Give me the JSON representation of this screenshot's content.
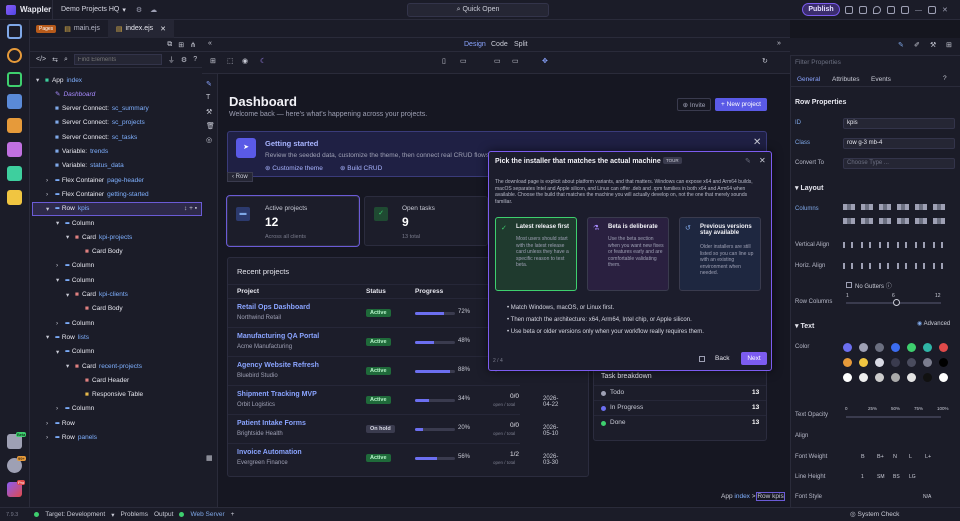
{
  "app": {
    "logo": "Wappler",
    "project": "Demo Projects HQ",
    "quick_open": "Quick Open",
    "publish": "Publish"
  },
  "tabs": [
    {
      "label": "Pages"
    },
    {
      "label": "main.ejs"
    },
    {
      "label": "index.ejs"
    }
  ],
  "tree": {
    "search_placeholder": "Find Elements",
    "nodes": [
      {
        "type": "App",
        "name": "index"
      },
      {
        "type": "Dashboard",
        "name": ""
      },
      {
        "type": "Server Connect:",
        "name": "sc_summary"
      },
      {
        "type": "Server Connect:",
        "name": "sc_projects"
      },
      {
        "type": "Server Connect:",
        "name": "sc_tasks"
      },
      {
        "type": "Variable:",
        "name": "trends"
      },
      {
        "type": "Variable:",
        "name": "status_data"
      },
      {
        "type": "Flex Container",
        "name": "page-header"
      },
      {
        "type": "Flex Container",
        "name": "getting-started"
      },
      {
        "type": "Row",
        "name": "kpis"
      },
      {
        "type": "Column",
        "name": ""
      },
      {
        "type": "Card",
        "name": "kpi-projects"
      },
      {
        "type": "Card Body",
        "name": ""
      },
      {
        "type": "Column",
        "name": ""
      },
      {
        "type": "Column",
        "name": ""
      },
      {
        "type": "Card",
        "name": "kpi-clients"
      },
      {
        "type": "Card Body",
        "name": ""
      },
      {
        "type": "Column",
        "name": ""
      },
      {
        "type": "Row",
        "name": "lists"
      },
      {
        "type": "Column",
        "name": ""
      },
      {
        "type": "Card",
        "name": "recent-projects"
      },
      {
        "type": "Card Header",
        "name": ""
      },
      {
        "type": "Responsive Table",
        "name": ""
      },
      {
        "type": "Column",
        "name": ""
      },
      {
        "type": "Row",
        "name": ""
      },
      {
        "type": "Row",
        "name": "panels"
      }
    ]
  },
  "view_modes": {
    "design": "Design",
    "code": "Code",
    "split": "Split"
  },
  "page": {
    "title": "Dashboard",
    "subtitle": "Welcome back — here's what's happening across your projects.",
    "invite": "Invite",
    "new_project": "+ New project",
    "banner_title": "Getting started",
    "banner_text": "Review the seeded data, customize the theme, then connect real CRUD flows.",
    "banner_link1": "Customize theme",
    "banner_link2": "Build CRUD",
    "row_chip": "Row",
    "kpi1": {
      "label": "Active projects",
      "value": "12",
      "sub": "Across all clients"
    },
    "kpi2": {
      "label": "Open tasks",
      "value": "9",
      "sub": "13 total"
    },
    "recent_title": "Recent projects",
    "cols": [
      "Project",
      "Status",
      "Progress"
    ],
    "projects": [
      {
        "name": "Retail Ops Dashboard",
        "client": "Northwind Retail",
        "status": "Active",
        "progress": 72,
        "pct": "72%"
      },
      {
        "name": "Manufacturing QA Portal",
        "client": "Acme Manufacturing",
        "status": "Active",
        "progress": 48,
        "pct": "48%"
      },
      {
        "name": "Agency Website Refresh",
        "client": "Bluebird Studio",
        "status": "Active",
        "progress": 88,
        "pct": "88%",
        "extra": "open / total"
      },
      {
        "name": "Shipment Tracking MVP",
        "client": "Orbit Logistics",
        "status": "Active",
        "progress": 34,
        "pct": "34%",
        "tasks": "0/0",
        "extra": "open / total",
        "date": "2026-04-22"
      },
      {
        "name": "Patient Intake Forms",
        "client": "Brightside Health",
        "status": "On hold",
        "progress": 20,
        "pct": "20%",
        "tasks": "0/0",
        "extra": "open / total",
        "date": "2026-05-10"
      },
      {
        "name": "Invoice Automation",
        "client": "Evergreen Finance",
        "status": "Active",
        "progress": 56,
        "pct": "56%",
        "tasks": "1/2",
        "extra": "open / total",
        "date": "2026-03-30"
      }
    ],
    "task_title": "Task breakdown",
    "tasks": [
      {
        "label": "Todo",
        "value": "13",
        "color": "#9ea0b4"
      },
      {
        "label": "In Progress",
        "value": "13",
        "color": "#6c6ff0"
      },
      {
        "label": "Done",
        "value": "13",
        "color": "#3ecf6e"
      }
    ]
  },
  "tour": {
    "title": "Pick the installer that matches the actual machine",
    "tag": "TOUR",
    "intro": "The download page is explicit about platform variants, and that matters. Windows can expose x64 and Arm64 builds, macOS separates Intel and Apple silicon, and Linux can offer .deb and .rpm families in both x64 and Arm64 when available. Choose the build that matches the machine you will actually develop on, not the one that merely sounds familiar.",
    "cards": [
      {
        "title": "Latest release first",
        "text": "Most users should start with the latest release card unless they have a specific reason to test beta."
      },
      {
        "title": "Beta is deliberate",
        "text": "Use the beta section when you want new fixes or features early and are comfortable validating them."
      },
      {
        "title": "Previous versions stay available",
        "text": "Older installers are still listed so you can line up with an existing environment when needed."
      }
    ],
    "bullets": [
      "Match Windows, macOS, or Linux first.",
      "Then match the architecture: x64, Arm64, Intel chip, or Apple silicon.",
      "Use beta or older versions only when your workflow really requires them."
    ],
    "step": "2 / 4",
    "back": "Back",
    "next": "Next"
  },
  "breadcrumb": {
    "app": "App",
    "app_name": "index",
    "sep": ">",
    "current": "Row kpis"
  },
  "props": {
    "filter_placeholder": "Filter Properties",
    "tabs": [
      "General",
      "Attributes",
      "Events"
    ],
    "row_properties": "Row Properties",
    "id_label": "ID",
    "id_value": "kpis",
    "class_label": "Class",
    "class_value": "row g-3 mb-4",
    "convert_label": "Convert To",
    "convert_placeholder": "Choose Type ...",
    "layout": "Layout",
    "columns": "Columns",
    "valign": "Vertical Align",
    "halign": "Horiz. Align",
    "no_gutters": "No Gutters",
    "row_columns": "Row Columns",
    "rc_ticks": [
      "1",
      "6",
      "12"
    ],
    "text": "Text",
    "advanced": "Advanced",
    "color": "Color",
    "swatches": [
      "#6c6ff0",
      "#9ea0b4",
      "#6b6f80",
      "#3b6cf0",
      "#3ecf6e",
      "#2fb5a6",
      "#e04a4a",
      "#e69a3a",
      "#f0c541",
      "#d8d9e4",
      "#3a3b4e",
      "#4a4c5e",
      "#7b7d8e",
      "#000000",
      "#ffffff",
      "#eeeeee",
      "#cccccc",
      "#aaaaaa",
      "#e4e4e4",
      "#111111",
      "#ffffff"
    ],
    "text_opacity": "Text Opacity",
    "opacity_ticks": [
      "0",
      "25%",
      "50%",
      "75%",
      "100%"
    ],
    "align": "Align",
    "font_weight": "Font Weight",
    "fw_opts": [
      "B",
      "B+",
      "N",
      "L",
      "L+"
    ],
    "line_height": "Line Height",
    "lh_opts": [
      "1",
      "SM",
      "BS",
      "LG"
    ],
    "font_style": "Font Style",
    "fs_opt": "N/A"
  },
  "status": {
    "version": "7.9.3",
    "target": "Target: Development",
    "problems": "Problems",
    "output": "Output",
    "server": "Web Server"
  },
  "rail_badges": {
    "b1": "Beta",
    "b2": "99+",
    "b3": "Pro"
  }
}
